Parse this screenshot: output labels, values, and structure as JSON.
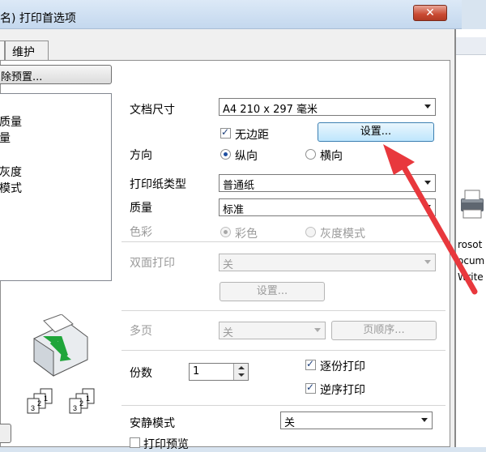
{
  "window": {
    "title": "名) 打印首选项",
    "close_label": "✕"
  },
  "tabs": [
    {
      "label": ""
    },
    {
      "label": "维护"
    }
  ],
  "left": {
    "preset_button": "除预置...",
    "list_items": [
      "质量",
      "量",
      "灰度",
      "模式"
    ]
  },
  "background_window": {
    "labels": [
      "rosot",
      "ocum",
      "Write"
    ]
  },
  "settings": {
    "doc_size": {
      "label": "文档尺寸",
      "value": "A4 210 x 297 毫米"
    },
    "borderless": {
      "label": "无边距",
      "checked": true
    },
    "setup_button": "设置...",
    "orientation": {
      "label": "方向",
      "portrait": "纵向",
      "landscape": "横向",
      "selected": "纵向"
    },
    "paper_type": {
      "label": "打印纸类型",
      "value": "普通纸"
    },
    "quality": {
      "label": "质量",
      "value": "标准"
    },
    "color": {
      "label": "色彩",
      "color_option": "彩色",
      "gray_option": "灰度模式",
      "selected": "彩色"
    },
    "duplex": {
      "label": "双面打印",
      "value": "关",
      "setup_button": "设置..."
    },
    "multipage": {
      "label": "多页",
      "value": "关",
      "order_button": "页顺序..."
    },
    "copies": {
      "label": "份数",
      "value": "1"
    },
    "collate": {
      "label": "逐份打印",
      "checked": true
    },
    "reverse": {
      "label": "逆序打印",
      "checked": true
    },
    "quiet_mode": {
      "label": "安静模式",
      "value": "关"
    },
    "print_preview": {
      "label": "打印预览",
      "checked": false
    }
  },
  "colors": {
    "annotation_arrow": "#e8383d"
  }
}
